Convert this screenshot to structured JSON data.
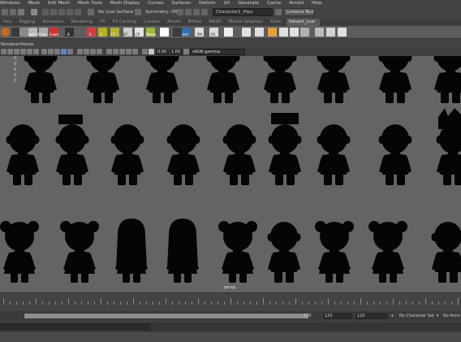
{
  "menubar": {
    "items": [
      "Windows",
      "Mesh",
      "Edit Mesh",
      "Mesh Tools",
      "Mesh Display",
      "Curves",
      "Surfaces",
      "Deform",
      "UV",
      "Generate",
      "Cache",
      "Arnold",
      "Help"
    ]
  },
  "statusline": {
    "live_surface": "No Live Surface",
    "symmetry": "Symmetry: Off",
    "object_name": "Character1_Hips",
    "user": "Lorence Buz"
  },
  "shelf": {
    "tabs": [
      "Poly",
      "Rigging",
      "Animation",
      "Rendering",
      "FX",
      "FX Caching",
      "Custom",
      "Arnold",
      "Bifrost",
      "MASH",
      "Motion Graphics",
      "XGen",
      "Deisart_Lnal"
    ],
    "active_tab": "Deisart_Lnal",
    "button_labels": [
      "Split_P",
      "Slide",
      "Insert",
      "B",
      "S",
      "F",
      "FT",
      "BT",
      "CP",
      "Merge",
      "Vert",
      "PM",
      "RS"
    ]
  },
  "panel": {
    "menus": [
      "Renderer",
      "Panels"
    ],
    "near_value": "0.00",
    "far_value": "1.00",
    "color_space": "sRGB gamma"
  },
  "viewport": {
    "camera_label": "persp",
    "axis_ticks": [
      "0",
      "0",
      "0",
      "0",
      "0"
    ]
  },
  "rangebar": {
    "start_value": "120",
    "end_value": "120",
    "end_value_2": "120",
    "character_set": "No Character Set",
    "anim_layer": "No Anim L"
  },
  "colors": {
    "viewport_bg": "#646464",
    "silhouette": "#050505",
    "ui_bg": "#444444",
    "shelf_bg": "#5d5d5d"
  }
}
